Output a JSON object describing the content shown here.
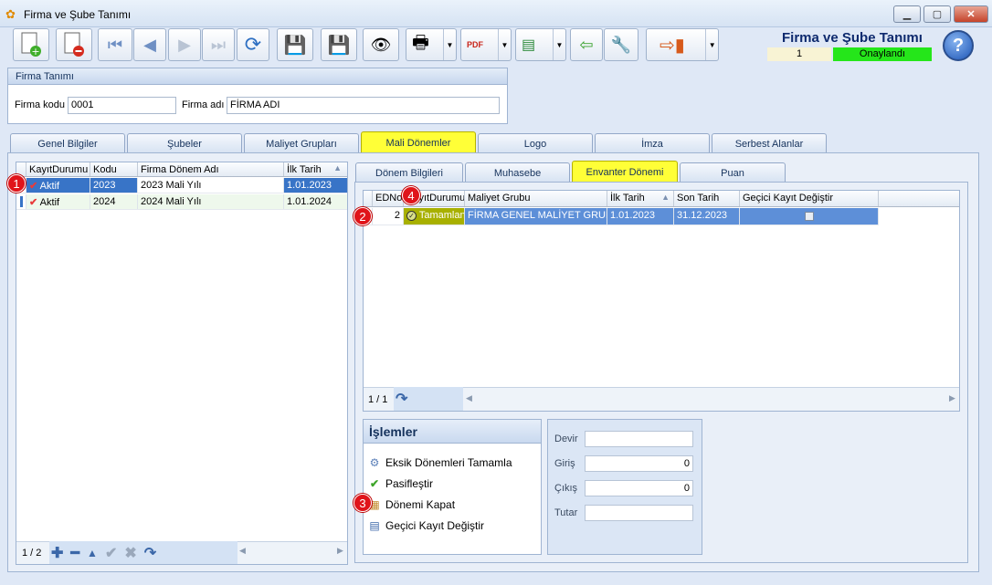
{
  "window": {
    "title": "Firma ve Şube Tanımı"
  },
  "header": {
    "brand": "Firma ve Şube Tanımı",
    "record_no": "1",
    "status": "Onaylandı"
  },
  "firma": {
    "group_title": "Firma Tanımı",
    "kod_label": "Firma kodu",
    "kod_value": "0001",
    "adi_label": "Firma adı",
    "adi_value": "FİRMA ADI"
  },
  "tabs": [
    "Genel Bilgiler",
    "Şubeler",
    "Maliyet Grupları",
    "Mali Dönemler",
    "Logo",
    "İmza",
    "Serbest Alanlar"
  ],
  "left_grid": {
    "columns": [
      "KayıtDurumu",
      "Kodu",
      "Firma Dönem Adı",
      "İlk Tarih"
    ],
    "rows": [
      [
        "Aktif",
        "2023",
        "2023 Mali Yılı",
        "1.01.2023"
      ],
      [
        "Aktif",
        "2024",
        "2024 Mali Yılı",
        "1.01.2024"
      ]
    ],
    "pager": "1 / 2"
  },
  "subtabs": [
    "Dönem Bilgileri",
    "Muhasebe",
    "Envanter Dönemi",
    "Puan"
  ],
  "right_grid": {
    "columns": [
      "EDNo",
      "KayıtDurumu",
      "Maliyet Grubu",
      "İlk Tarih",
      "Son Tarih",
      "Geçici Kayıt Değiştir"
    ],
    "rows": [
      [
        "2",
        "Tamamlan",
        "FİRMA GENEL MALİYET GRUBU",
        "1.01.2023",
        "31.12.2023",
        ""
      ]
    ],
    "pager": "1 / 1"
  },
  "islemler": {
    "title": "İşlemler",
    "items": [
      "Eksik Dönemleri Tamamla",
      "Pasifleştir",
      "Dönemi Kapat",
      "Geçici Kayıt Değiştir"
    ]
  },
  "summary": {
    "fields": [
      {
        "label": "Devir",
        "value": ""
      },
      {
        "label": "Giriş",
        "value": "0"
      },
      {
        "label": "Çıkış",
        "value": "0"
      },
      {
        "label": "Tutar",
        "value": ""
      }
    ]
  },
  "badges": [
    "1",
    "2",
    "3",
    "4"
  ]
}
